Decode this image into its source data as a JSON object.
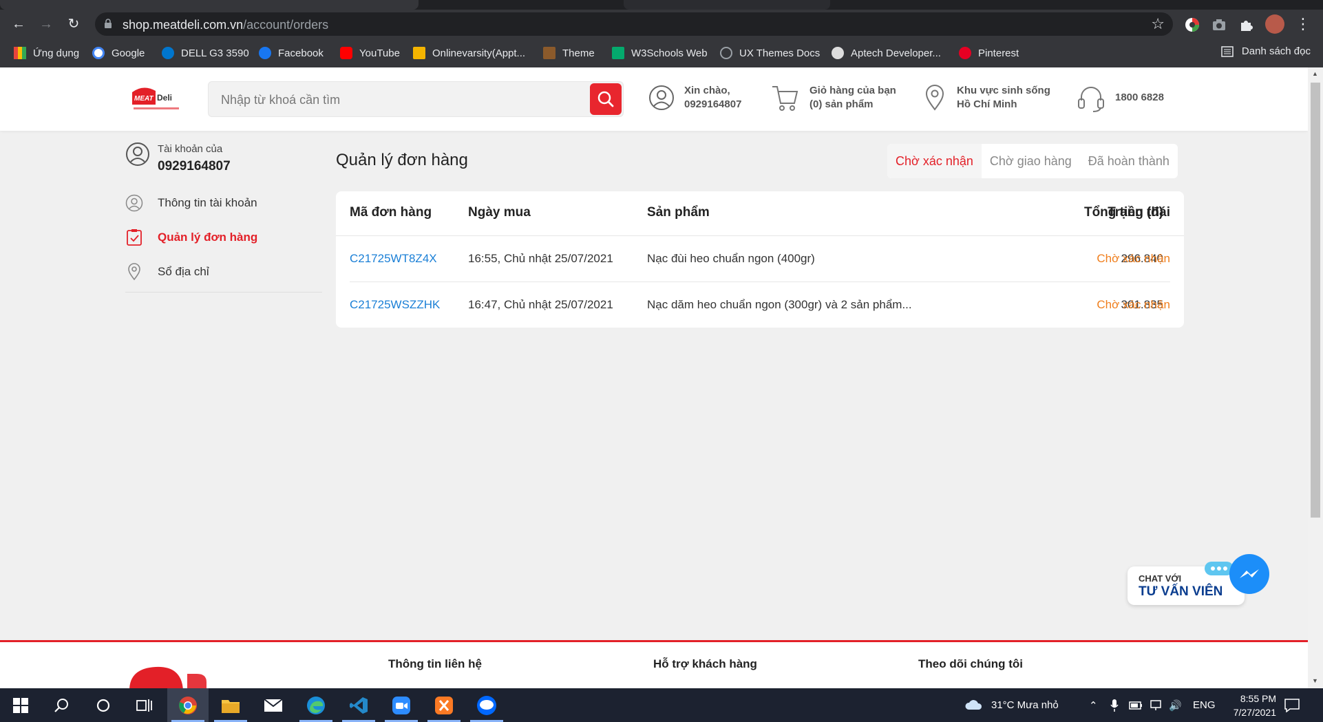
{
  "browser": {
    "url_host": "shop.meatdeli.com.vn",
    "url_path": "/account/orders",
    "bookmarks": [
      {
        "label": "Ứng dụng",
        "icon": "apps-grid-icon",
        "color": "#e8453c"
      },
      {
        "label": "Google",
        "icon": "google-icon",
        "color": "#ffffff"
      },
      {
        "label": "DELL G3 3590",
        "icon": "dell-icon",
        "color": "#0076ce"
      },
      {
        "label": "Facebook",
        "icon": "facebook-icon",
        "color": "#1877f2"
      },
      {
        "label": "YouTube",
        "icon": "youtube-icon",
        "color": "#ff0000"
      },
      {
        "label": "Onlinevarsity(Appt...",
        "icon": "onlinevarsity-icon",
        "color": "#f4b400"
      },
      {
        "label": "Theme",
        "icon": "theme-icon",
        "color": "#a0522d"
      },
      {
        "label": "W3Schools Web",
        "icon": "w3schools-icon",
        "color": "#04aa6d"
      },
      {
        "label": "UX Themes Docs",
        "icon": "ux-themes-icon",
        "color": "#9aa0a6"
      },
      {
        "label": "Aptech Developer...",
        "icon": "aptech-icon",
        "color": "#dddddd"
      },
      {
        "label": "Pinterest",
        "icon": "pinterest-icon",
        "color": "#e60023"
      }
    ],
    "reading_list": "Danh sách đọc"
  },
  "header": {
    "search_placeholder": "Nhập từ khoá cần tìm",
    "greeting_line1": "Xin chào,",
    "greeting_line2": "0929164807",
    "cart_line1": "Giỏ hàng của bạn",
    "cart_line2": "(0) sản phẩm",
    "region_line1": "Khu vực sinh sống",
    "region_line2": "Hồ Chí Minh",
    "hotline": "1800 6828"
  },
  "sidebar": {
    "account_label": "Tài khoản của",
    "account_phone": "0929164807",
    "items": [
      {
        "label": "Thông tin tài khoản",
        "icon": "user-icon"
      },
      {
        "label": "Quản lý đơn hàng",
        "icon": "clipboard-check-icon",
        "active": true
      },
      {
        "label": "Sổ địa chỉ",
        "icon": "location-pin-icon"
      }
    ]
  },
  "main": {
    "title": "Quản lý đơn hàng",
    "tabs": [
      {
        "label": "Chờ xác nhận",
        "active": true
      },
      {
        "label": "Chờ giao hàng"
      },
      {
        "label": "Đã hoàn thành"
      }
    ],
    "columns": [
      "Mã đơn hàng",
      "Ngày mua",
      "Sản phẩm",
      "Tổng tiền (đ)",
      "Trạng thái"
    ],
    "orders": [
      {
        "code": "C21725WT8Z4X",
        "date": "16:55, Chủ nhật 25/07/2021",
        "product": "Nạc đùi heo chuẩn ngon (400gr)",
        "total": "296.840",
        "status": "Chờ xác nhận"
      },
      {
        "code": "C21725WSZZHK",
        "date": "16:47, Chủ nhật 25/07/2021",
        "product": "Nạc dăm heo chuẩn ngon (300gr) và 2 sản phẩm...",
        "total": "301.835",
        "status": "Chờ xác nhận"
      }
    ]
  },
  "chat_widget": {
    "line1": "CHAT VỚI",
    "line2": "TƯ VẤN VIÊN"
  },
  "footer": {
    "col1": "Thông tin liên hệ",
    "col2": "Hỗ trợ khách hàng",
    "col3": "Theo dõi chúng tôi"
  },
  "taskbar": {
    "weather": "31°C  Mưa nhỏ",
    "language": "ENG",
    "time": "8:55 PM",
    "date": "7/27/2021"
  },
  "colors": {
    "brand_red": "#e32028",
    "link_blue": "#1a7fd6",
    "status_orange": "#f07e1c"
  }
}
